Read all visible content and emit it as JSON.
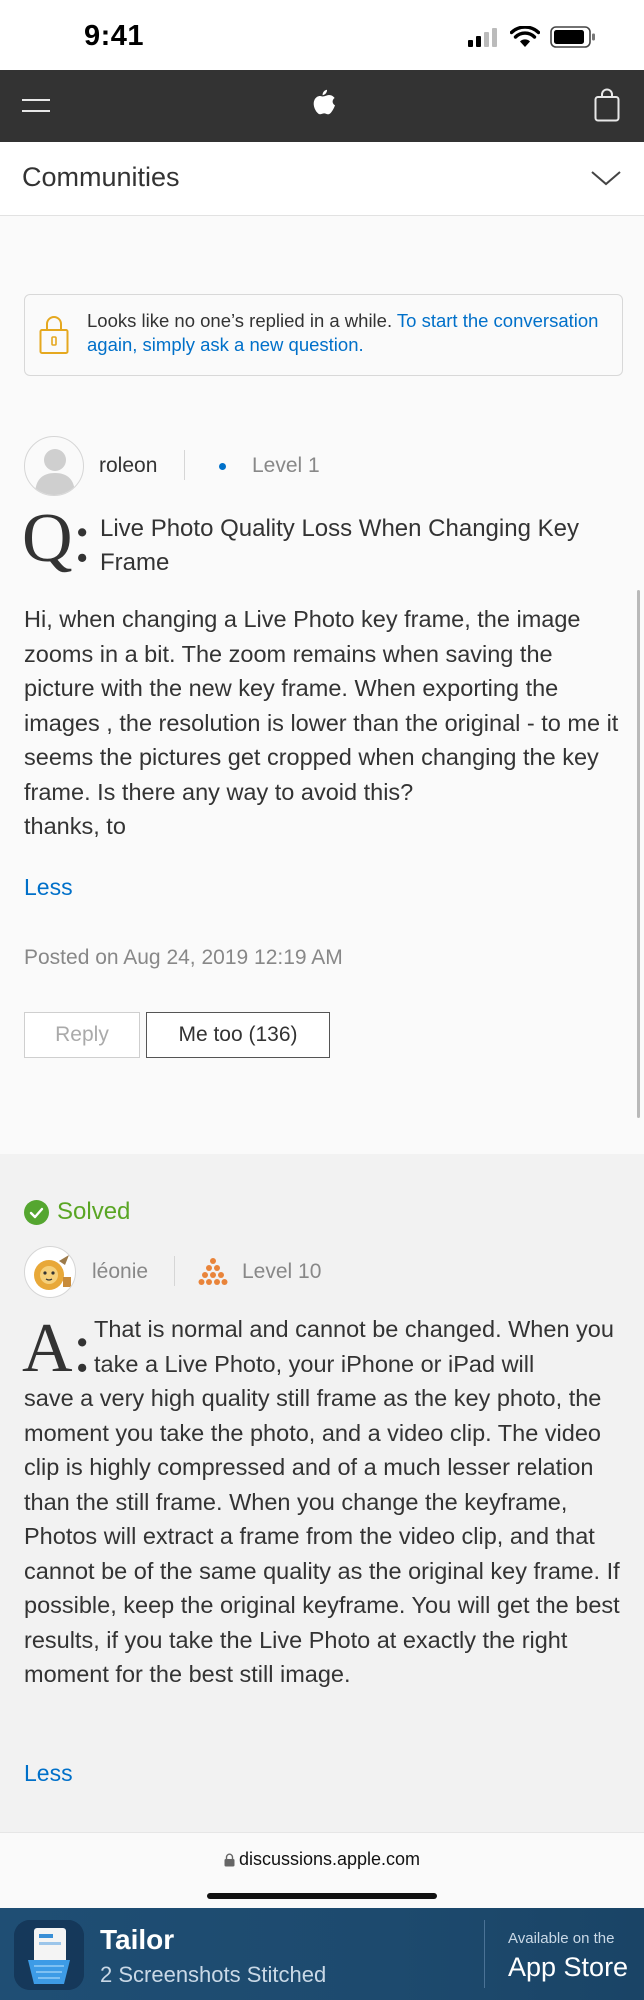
{
  "status_bar": {
    "time": "9:41"
  },
  "nav": {
    "section_title": "Communities"
  },
  "notice": {
    "text": "Looks like no one’s replied in a while. ",
    "link": "To start the conversation again, simply ask a new question."
  },
  "question": {
    "author": "roleon",
    "level": "Level 1",
    "q_mark": "Q:",
    "title": "Live Photo Quality Loss When Changing Key Frame",
    "body": "Hi, when changing a Live Photo key frame, the image zooms in a bit.  The zoom remains when saving the picture with the new key frame. When exporting the images , the resolution is lower than the original - to me it seems the pictures get cropped when changing the key frame. Is there any way to avoid this?\nthanks, to",
    "less": "Less",
    "posted": "Posted on Aug 24, 2019 12:19 AM",
    "reply_label": "Reply",
    "metoo_label": "Me too (136)"
  },
  "answer": {
    "solved_label": "Solved",
    "author": "léonie",
    "level": "Level 10",
    "a_mark": "A:",
    "body_first": "That is normal and cannot be changed. When you take a Live Photo, your iPhone or iPad will",
    "body_rest": "save a very high quality still frame as the key photo, the moment you take the photo, and a video clip. The video clip is highly compressed and of a much lesser relation than the still frame. When you change the keyframe, Photos will extract a frame from the video clip, and that cannot be of the same quality as the original key frame. If possible, keep the original keyframe. You will get the best results, if you take the Live Photo at exactly the right moment for the best still image.",
    "less": "Less"
  },
  "browser": {
    "url": "discussions.apple.com"
  },
  "banner": {
    "app_name": "Tailor",
    "app_subtitle": "2 Screenshots Stitched",
    "store_top": "Available on the",
    "store_main": "App Store"
  },
  "colors": {
    "link": "#0070c9",
    "solved": "#5aa624",
    "nav_bg": "#333333",
    "banner_bg": "#1f4e74"
  }
}
